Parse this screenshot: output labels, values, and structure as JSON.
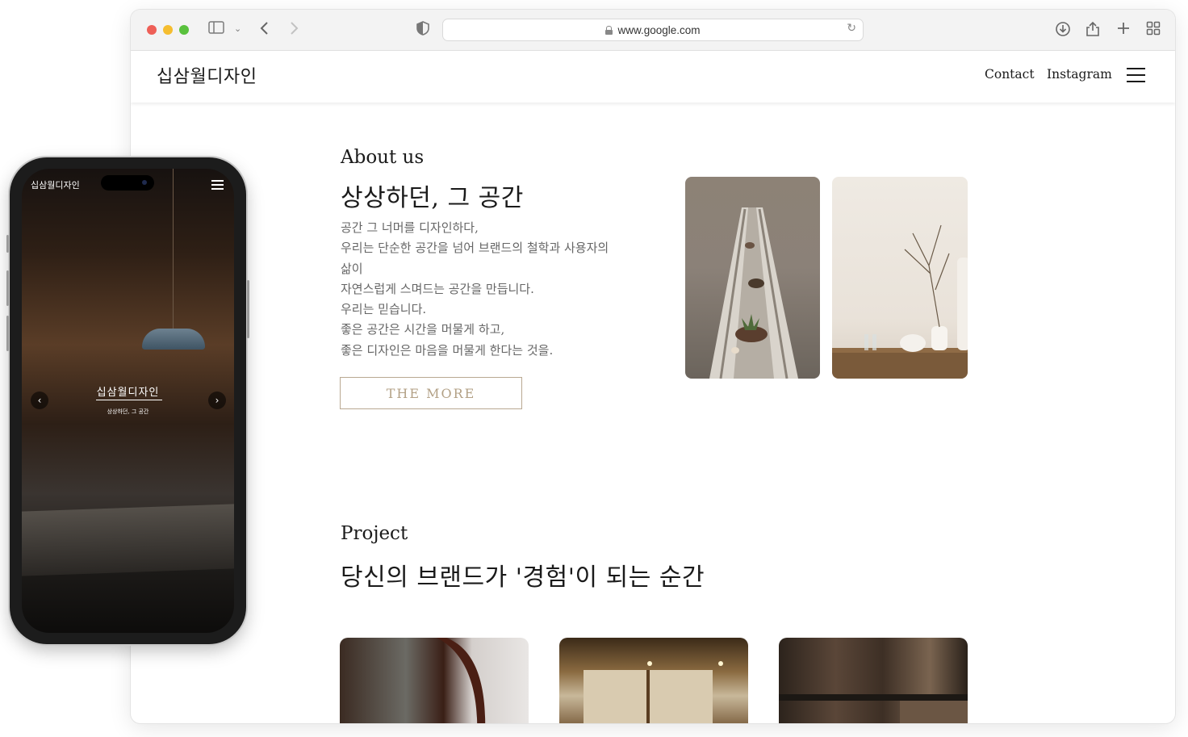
{
  "browser": {
    "url": "www.google.com"
  },
  "site": {
    "logo": "십삼월디자인",
    "nav": {
      "contact": "Contact",
      "instagram": "Instagram"
    }
  },
  "about": {
    "eyebrow": "About us",
    "title": "상상하던, 그 공간",
    "body": [
      "공간 그 너머를 디자인하다,",
      "우리는 단순한 공간을 넘어 브랜드의 철학과 사용자의 삶이",
      "자연스럽게 스며드는 공간을 만듭니다.",
      "우리는 믿습니다.",
      "좋은 공간은 시간을 머물게 하고,",
      "좋은 디자인은 마음을 머물게 한다는 것을."
    ],
    "button": "THE MORE"
  },
  "project": {
    "eyebrow": "Project",
    "title": "당신의 브랜드가 '경험'이 되는 순간"
  },
  "phone": {
    "logo": "십삼월디자인",
    "hero_title": "십삼월디자인",
    "hero_subtitle": "상상하던, 그 공간"
  },
  "icons": {
    "sidebar": "sidebar-icon",
    "back": "chevron-left-icon",
    "forward": "chevron-right-icon",
    "shield": "shield-icon",
    "download": "download-icon",
    "share": "share-icon",
    "new_tab": "plus-icon",
    "tabs": "tab-overview-icon"
  },
  "colors": {
    "accent_button_text": "#b3a186",
    "accent_button_border": "#b9a891",
    "body_text": "#666666"
  }
}
